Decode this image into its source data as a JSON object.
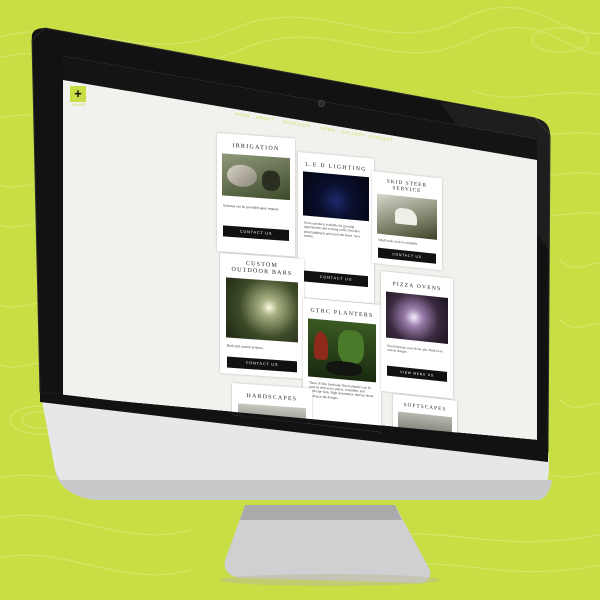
{
  "brand": {
    "logo_mark": "+",
    "logo_text": "SHARE"
  },
  "nav": {
    "items": [
      "HOME",
      "ABOUT",
      "SERVICES",
      "NEWS",
      "GALLERY",
      "CONTACT"
    ]
  },
  "cards": [
    {
      "title": "IRRIGATION",
      "text": "Systems can be provided upon request.",
      "button": "CONTACT US"
    },
    {
      "title": "L.E.D LIGHTING",
      "text": "Newer products available for growing opportunities and evening walks. Provides great lighting in and out of the home. Save money.",
      "button": "CONTACT US"
    },
    {
      "title": "SKID STEER SERVICE",
      "text": "Small scale services available.",
      "button": "CONTACT US"
    },
    {
      "title": "CUSTOM OUTDOOR BARS",
      "text": "Built and custom projects.",
      "button": "CONTACT US"
    },
    {
      "title": "GTRC PLANTERS",
      "text": "These 30 litre landscape flower planters can be used on driveways, patios, verandahs, and landscape beds. High end planters that last about as long as the designs.",
      "button": ""
    },
    {
      "title": "PIZZA OVENS",
      "text": "Wood burning ovens & fire pits. Built from custom designs.",
      "button": "VIEW MENU US"
    },
    {
      "title": "HARDSCAPES",
      "text": "",
      "button": ""
    },
    {
      "title": "SOFTSCAPES",
      "text": "",
      "button": ""
    }
  ],
  "colors": {
    "accent": "#c9dd45",
    "bar": "#141414",
    "button": "#111111",
    "page_bg": "#f3f3ef"
  }
}
